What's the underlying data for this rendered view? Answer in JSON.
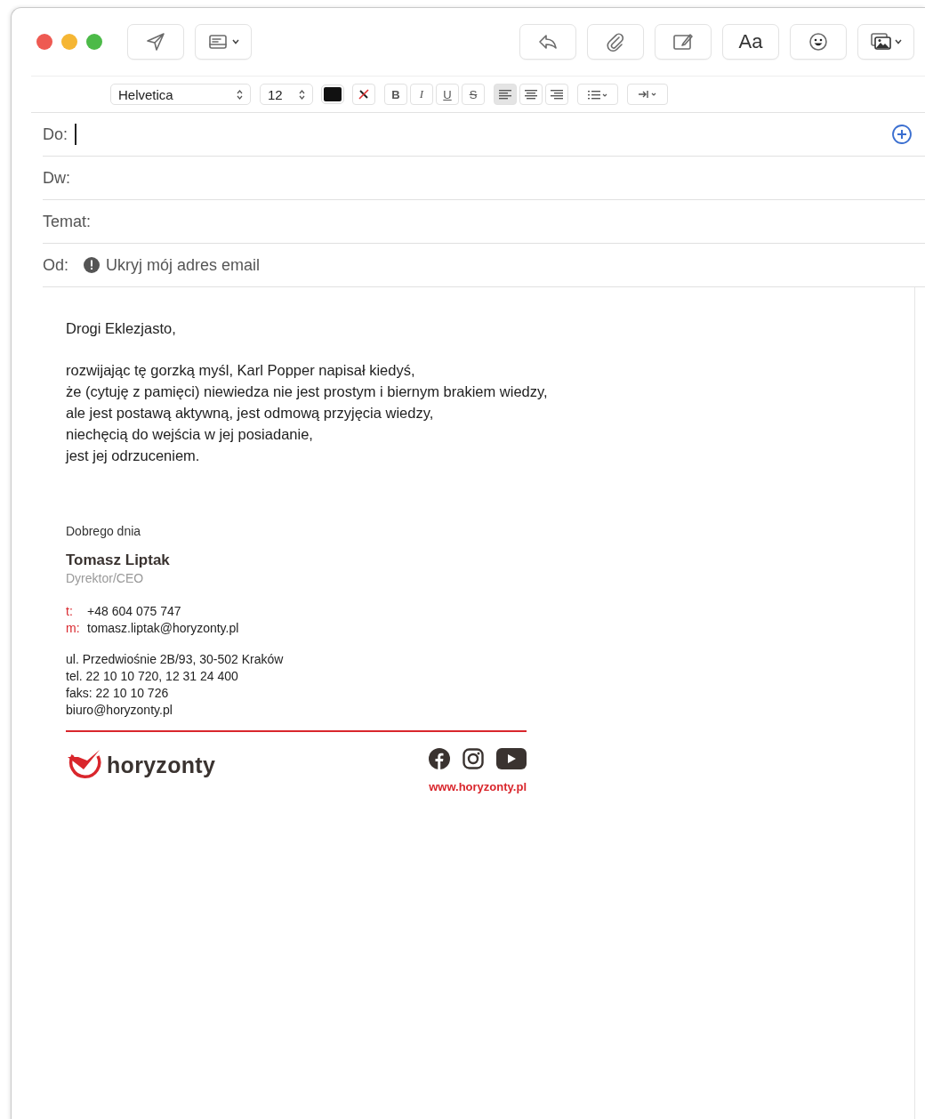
{
  "toolbar": {
    "left": [
      {
        "kind": "send"
      },
      {
        "kind": "header",
        "menu": true
      }
    ],
    "right": [
      {
        "kind": "reply"
      },
      {
        "kind": "attach"
      },
      {
        "kind": "markup"
      },
      {
        "kind": "fonts",
        "label": "Aa"
      },
      {
        "kind": "emoji"
      },
      {
        "kind": "photo",
        "menu": true
      }
    ]
  },
  "format_bar": {
    "font": "Helvetica",
    "size": "12",
    "styles": [
      {
        "kind": "bold",
        "label": "B"
      },
      {
        "kind": "italic",
        "label": "I"
      },
      {
        "kind": "underline",
        "label": "U"
      },
      {
        "kind": "strike",
        "label": "S"
      }
    ],
    "align": [
      {
        "kind": "left",
        "selected": true
      },
      {
        "kind": "center",
        "selected": false
      },
      {
        "kind": "right",
        "selected": false
      }
    ]
  },
  "fields": [
    {
      "label": "Do:",
      "focused": true,
      "add_button": true
    },
    {
      "label": "Dw:",
      "focused": false,
      "add_button": false
    },
    {
      "label": "Temat:",
      "focused": false,
      "add_button": false
    }
  ],
  "from": {
    "label": "Od:",
    "value": "Ukryj mój adres email"
  },
  "body": {
    "greeting": "Drogi Eklezjasto,",
    "lines": [
      "rozwijając tę gorzką myśl, Karl Popper napisał kiedyś,",
      "że (cytuję z pamięci) niewiedza nie jest prostym i biernym brakiem wiedzy,",
      "ale jest postawą aktywną, jest odmową przyjęcia wiedzy,",
      "niechęcią do wejścia w jej posiadanie,",
      "jest jej odrzuceniem."
    ]
  },
  "signature": {
    "closing": "Dobrego dnia",
    "name": "Tomasz Liptak",
    "role": "Dyrektor/CEO",
    "contacts": [
      {
        "key": "t:",
        "value": "+48 604 075 747"
      },
      {
        "key": "m:",
        "value": "tomasz.liptak@horyzonty.pl"
      }
    ],
    "address": [
      "ul. Przedwiośnie 2B/93, 30-502 Kraków",
      "tel. 22 10 10 720, 12 31 24 400",
      "faks: 22 10 10 726",
      "biuro@horyzonty.pl"
    ],
    "brand": "horyzonty",
    "social": [
      {
        "kind": "facebook"
      },
      {
        "kind": "instagram"
      },
      {
        "kind": "youtube"
      }
    ],
    "website": "www.horyzonty.pl"
  }
}
